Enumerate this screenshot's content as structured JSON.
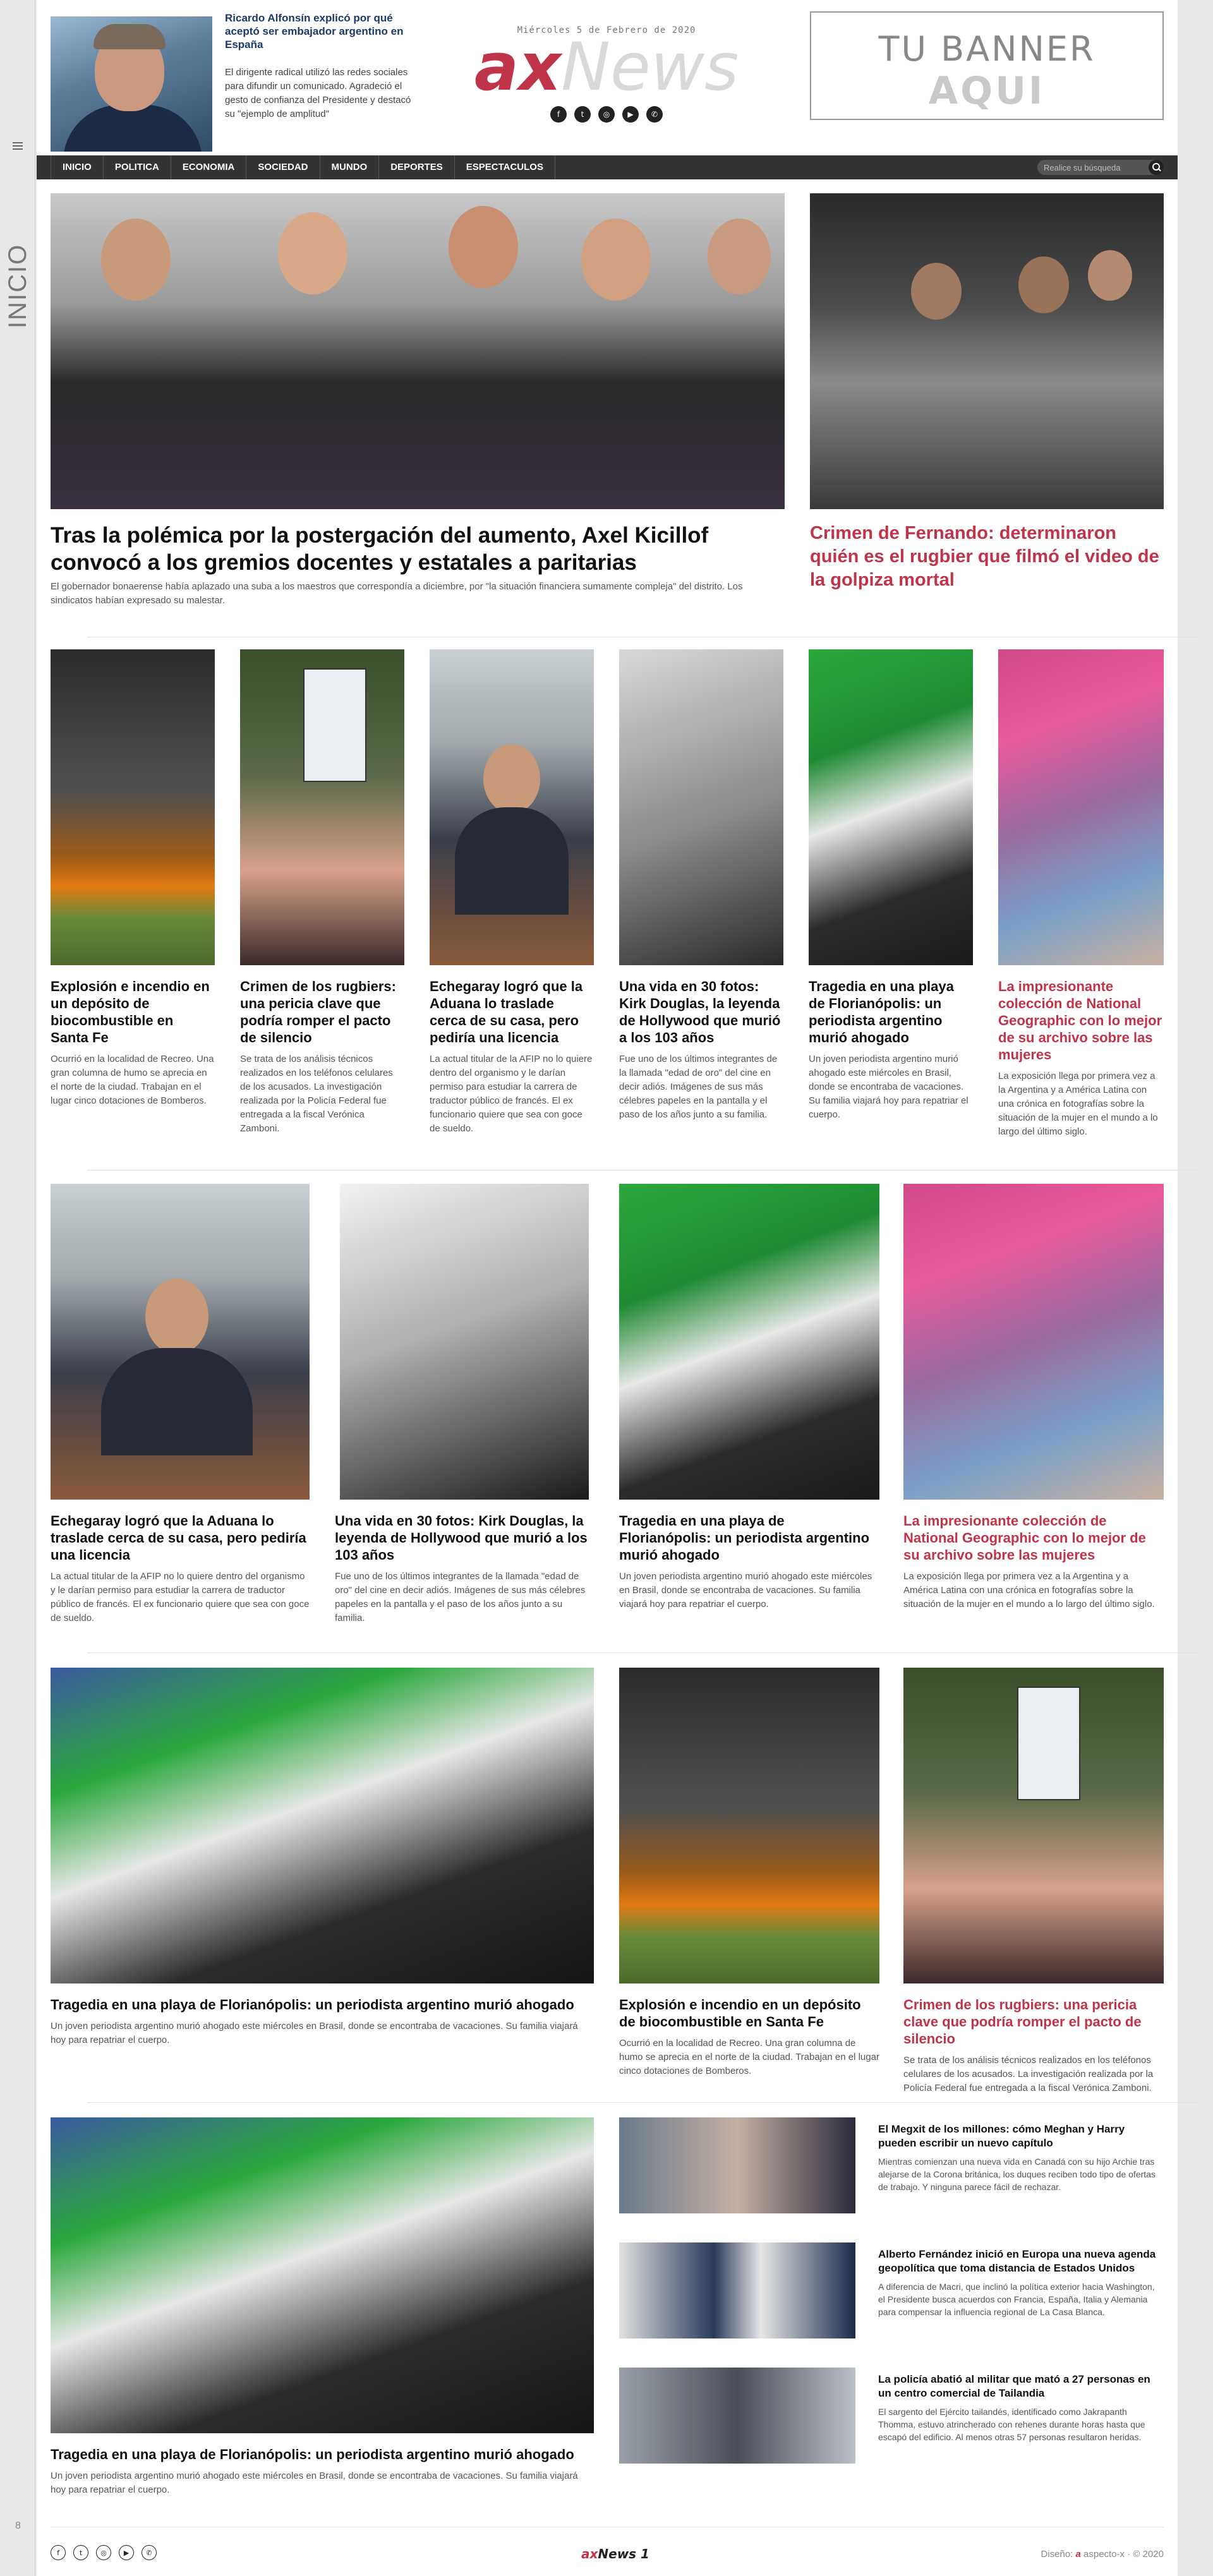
{
  "rail": {
    "section": "INICIO",
    "page_number": "8"
  },
  "header": {
    "story": {
      "title": "Ricardo Alfonsín explicó por qué aceptó ser embajador argentino en España",
      "summary": "El dirigente radical utilizó las redes sociales para difundir un comunicado. Agradeció el gesto de confianza del Presidente y destacó su \"ejemplo de amplitud\""
    },
    "date": "Miércoles 5 de Febrero de 2020",
    "logo": {
      "ax": "ax",
      "news": "News"
    },
    "social": [
      "facebook-icon",
      "twitter-icon",
      "instagram-icon",
      "youtube-icon",
      "whatsapp-icon"
    ],
    "banner": {
      "line1": "TU BANNER",
      "line2": "AQUI"
    }
  },
  "nav": {
    "items": [
      "INICIO",
      "POLITICA",
      "ECONOMIA",
      "SOCIEDAD",
      "MUNDO",
      "DEPORTES",
      "ESPECTACULOS"
    ],
    "search_placeholder": "Realice su búsqueda"
  },
  "hero": {
    "main": {
      "title": "Tras la polémica por la postergación del aumento, Axel Kicillof convocó a los gremios docentes y estatales a paritarias",
      "summary": "El gobernador bonaerense había aplazado una suba a los maestros que correspondía a diciembre, por \"la situación financiera sumamente compleja\" del distrito. Los sindicatos habían expresado su malestar."
    },
    "side": {
      "title": "Crimen de Fernando: determinaron quién es el rugbier que filmó el video de la golpiza mortal"
    }
  },
  "row1": [
    {
      "title": "Explosión e incendio en un depósito de biocombustible en Santa Fe",
      "summary": "Ocurrió en la localidad de Recreo. Una gran columna de humo se aprecia en el norte de la ciudad. Trabajan en el lugar cinco dotaciones de Bomberos."
    },
    {
      "title": "Crimen de los rugbiers: una pericia clave que podría romper el pacto de silencio",
      "summary": "Se trata de los análisis técnicos realizados en los teléfonos celulares de los acusados. La investigación realizada por la Policía Federal fue entregada a la fiscal Verónica Zamboni."
    },
    {
      "title": "Echegaray logró que la Aduana lo traslade cerca de su casa, pero pediría una licencia",
      "summary": "La actual titular de la AFIP no lo quiere dentro del organismo y le darían permiso para estudiar la carrera de traductor público de francés. El ex funcionario quiere que sea con goce de sueldo."
    },
    {
      "title": "Una vida en 30 fotos: Kirk Douglas, la leyenda de Hollywood que murió a los 103 años",
      "summary": "Fue uno de los últimos integrantes de la llamada \"edad de oro\" del cine en decir adiós. Imágenes de sus más célebres papeles en la pantalla y el paso de los años junto a su familia."
    },
    {
      "title": "Tragedia en una playa de Florianópolis: un periodista argentino murió ahogado",
      "summary": "Un joven periodista argentino murió ahogado este miércoles en Brasil, donde se encontraba de vacaciones. Su familia viajará hoy para repatriar el cuerpo."
    },
    {
      "title": "La impresionante colección de National Geographic con lo mejor de su archivo sobre las mujeres",
      "summary": "La exposición llega por primera vez a la Argentina y a América Latina con una crónica en fotografías sobre la situación de la mujer en el mundo a lo largo del último siglo."
    }
  ],
  "row2": [
    {
      "title": "Echegaray logró que la Aduana lo traslade cerca de su casa, pero pediría una licencia",
      "summary": "La actual titular de la AFIP no lo quiere dentro del organismo y le darían permiso para estudiar la carrera de traductor público de francés. El ex funcionario quiere que sea con goce de sueldo."
    },
    {
      "title": "Una vida en 30 fotos: Kirk Douglas, la leyenda de Hollywood que murió a los 103 años",
      "summary": "Fue uno de los últimos integrantes de la llamada \"edad de oro\" del cine en decir adiós. Imágenes de sus más célebres papeles en la pantalla y el paso de los años junto a su familia."
    },
    {
      "title": "Tragedia en una playa de Florianópolis: un periodista argentino murió ahogado",
      "summary": "Un joven periodista argentino murió ahogado este miércoles en Brasil, donde se encontraba de vacaciones. Su familia viajará hoy para repatriar el cuerpo."
    },
    {
      "title": "La impresionante colección de National Geographic con lo mejor de su archivo sobre las mujeres",
      "summary": "La exposición llega por primera vez a la Argentina y a América Latina con una crónica en fotografías sobre la situación de la mujer en el mundo a lo largo del último siglo."
    }
  ],
  "row3": [
    {
      "title": "Tragedia en una playa de Florianópolis: un periodista argentino murió ahogado",
      "summary": "Un joven periodista argentino murió ahogado este miércoles en Brasil, donde se encontraba de vacaciones. Su familia viajará hoy para repatriar el cuerpo."
    },
    {
      "title": "Explosión e incendio en un depósito de biocombustible en Santa Fe",
      "summary": "Ocurrió en la localidad de Recreo. Una gran columna de humo se aprecia en el norte de la ciudad. Trabajan en el lugar cinco dotaciones de Bomberos."
    },
    {
      "title": "Crimen de los rugbiers: una pericia clave que podría romper el pacto de silencio",
      "summary": "Se trata de los análisis técnicos realizados en los teléfonos celulares de los acusados. La investigación realizada por la Policía Federal fue entregada a la fiscal Verónica Zamboni."
    }
  ],
  "row4": {
    "main": {
      "title": "Tragedia en una playa de Florianópolis: un periodista argentino murió ahogado",
      "summary": "Un joven periodista argentino murió ahogado este miércoles en Brasil, donde se encontraba de vacaciones. Su familia viajará hoy para repatriar el cuerpo."
    },
    "list": [
      {
        "title": "El Megxit de los millones: cómo Meghan y Harry pueden escribir un nuevo capítulo",
        "summary": "Mientras comienzan una nueva vida en Canadá con su hijo Archie tras alejarse de la Corona británica, los duques reciben todo tipo de ofertas de trabajo. Y ninguna parece fácil de rechazar."
      },
      {
        "title": "Alberto Fernández inició en Europa una nueva agenda geopolítica que toma distancia de Estados Unidos",
        "summary": "A diferencia de Macri, que inclinó la política exterior hacia Washington, el Presidente busca acuerdos con Francia, España, Italia y Alemania para compensar la influencia regional de La Casa Blanca."
      },
      {
        "title": "La policía abatió al militar que mató a 27 personas en un centro comercial de Tailandia",
        "summary": "El sargento del Ejército tailandés, identificado como Jakrapanth Thomma, estuvo atrincherado con rehenes durante horas hasta que escapó del edificio. Al menos otras 57 personas resultaron heridas."
      }
    ]
  },
  "footer": {
    "logo": {
      "ax": "ax",
      "news": "News 1"
    },
    "credit_prefix": "Diseño:",
    "credit_brand": "a",
    "credit_name": "aspecto-x",
    "credit_year": "· © 2020"
  },
  "colors": {
    "accent": "#c0344a",
    "nav_bg": "#333333",
    "link_blue": "#1a3a6a"
  }
}
